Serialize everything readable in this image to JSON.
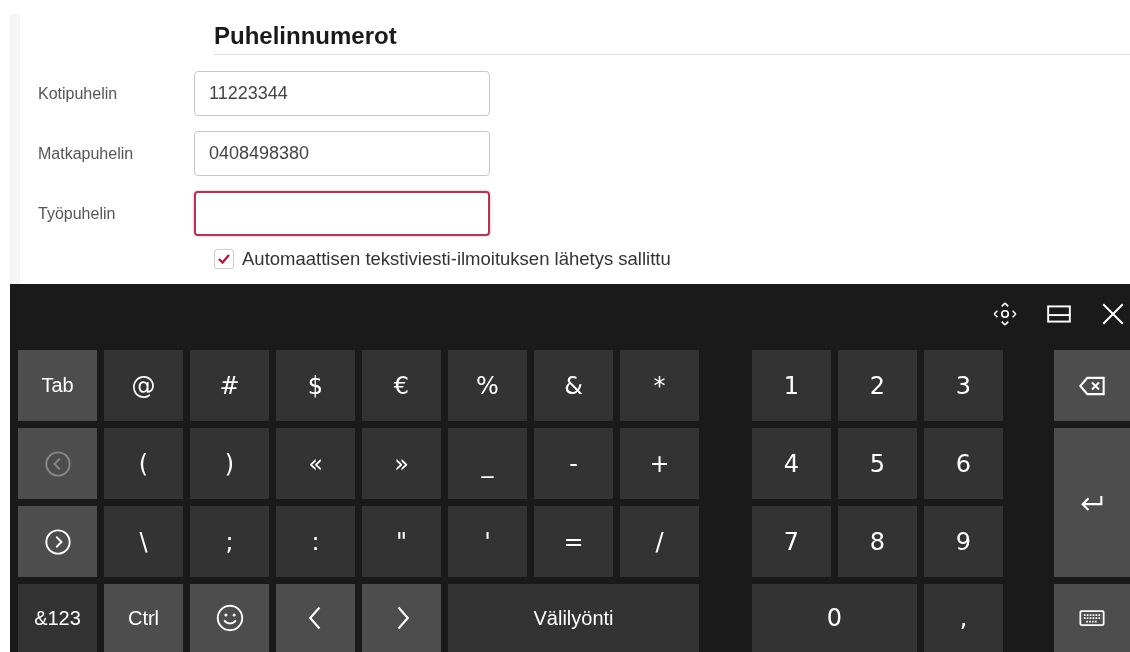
{
  "section": {
    "title": "Puhelinnumerot"
  },
  "fields": [
    {
      "label": "Kotipuhelin",
      "value": "11223344",
      "focused": false
    },
    {
      "label": "Matkapuhelin",
      "value": "0408498380",
      "focused": false
    },
    {
      "label": "Työpuhelin",
      "focused": true
    }
  ],
  "sms_permission": {
    "label": "Automaattisen tekstiviesti-ilmoituksen lähetys sallittu",
    "checked": true
  },
  "keyboard": {
    "toolbar": [
      {
        "kind": "move"
      },
      {
        "kind": "dock"
      },
      {
        "kind": "close"
      }
    ],
    "main_rows": [
      [
        {
          "kind": "function",
          "label": "Tab",
          "disabled": false
        },
        {
          "kind": "char",
          "label": "@",
          "disabled": false
        },
        {
          "kind": "char",
          "label": "#",
          "disabled": false
        },
        {
          "kind": "char",
          "label": "$",
          "disabled": false
        },
        {
          "kind": "char",
          "label": "€",
          "disabled": false
        },
        {
          "kind": "char",
          "label": "%",
          "disabled": false
        },
        {
          "kind": "char",
          "label": "&",
          "disabled": false
        },
        {
          "kind": "char",
          "label": "*",
          "disabled": false
        }
      ],
      [
        {
          "kind": "prev-page",
          "disabled": true
        },
        {
          "kind": "char",
          "label": "(",
          "disabled": false
        },
        {
          "kind": "char",
          "label": ")",
          "disabled": false
        },
        {
          "kind": "char",
          "label": "«",
          "disabled": false
        },
        {
          "kind": "char",
          "label": "»",
          "disabled": false
        },
        {
          "kind": "char",
          "label": "_",
          "disabled": false
        },
        {
          "kind": "char",
          "label": "-",
          "disabled": false
        },
        {
          "kind": "char",
          "label": "+",
          "disabled": false
        }
      ],
      [
        {
          "kind": "next-page",
          "disabled": false
        },
        {
          "kind": "char",
          "label": "\\",
          "disabled": false
        },
        {
          "kind": "char",
          "label": ";",
          "disabled": false
        },
        {
          "kind": "char",
          "label": ":",
          "disabled": false
        },
        {
          "kind": "char",
          "label": "\"",
          "disabled": false
        },
        {
          "kind": "char",
          "label": "'",
          "disabled": false
        },
        {
          "kind": "char",
          "label": "=",
          "disabled": false
        },
        {
          "kind": "char",
          "label": "/",
          "disabled": false
        }
      ],
      [
        {
          "kind": "char",
          "label": "&123",
          "disabled": false
        },
        {
          "kind": "function",
          "label": "Ctrl",
          "disabled": false
        },
        {
          "kind": "emoji",
          "disabled": false
        },
        {
          "kind": "left",
          "disabled": false
        },
        {
          "kind": "right",
          "disabled": false
        },
        {
          "kind": "char",
          "label": "Välilyönti",
          "disabled": false
        }
      ]
    ],
    "numpad_rows": [
      [
        {
          "kind": "char",
          "label": "1",
          "disabled": false
        },
        {
          "kind": "char",
          "label": "2",
          "disabled": false
        },
        {
          "kind": "char",
          "label": "3",
          "disabled": false
        }
      ],
      [
        {
          "kind": "char",
          "label": "4",
          "disabled": false
        },
        {
          "kind": "char",
          "label": "5",
          "disabled": false
        },
        {
          "kind": "char",
          "label": "6",
          "disabled": false
        }
      ],
      [
        {
          "kind": "char",
          "label": "7",
          "disabled": false
        },
        {
          "kind": "char",
          "label": "8",
          "disabled": false
        },
        {
          "kind": "char",
          "label": "9",
          "disabled": false
        }
      ],
      [
        {
          "kind": "char",
          "label": "0",
          "disabled": false
        },
        {
          "kind": "char",
          "label": ",",
          "disabled": false
        }
      ]
    ],
    "side_keys": [
      {
        "kind": "backspace",
        "disabled": false
      },
      {
        "kind": "enter",
        "disabled": false
      },
      {
        "kind": "keyboard",
        "disabled": false
      }
    ]
  }
}
